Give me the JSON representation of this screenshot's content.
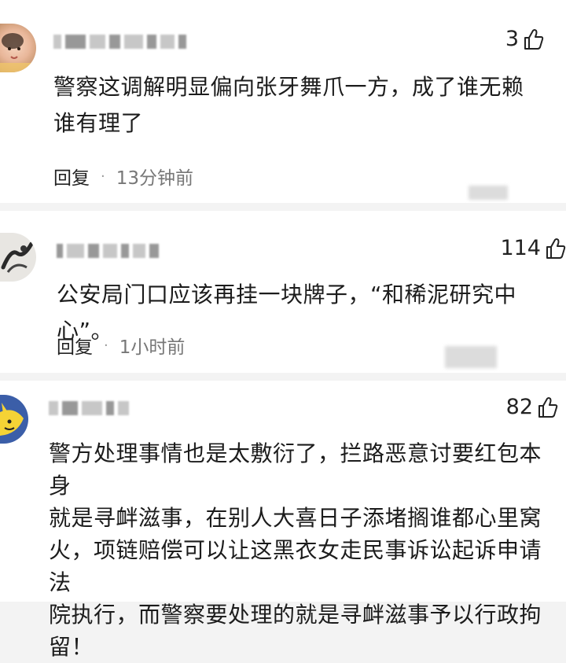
{
  "comments": [
    {
      "likes": "3",
      "text_lines": [
        "警察这调解明显偏向张牙舞爪一方，成了谁无赖",
        "谁有理了"
      ],
      "reply_label": "回复",
      "time": "13分钟前"
    },
    {
      "likes": "114",
      "text_lines": [
        "公安局门口应该再挂一块牌子，“和稀泥研究中心”。"
      ],
      "reply_label": "回复",
      "time": "1小时前"
    },
    {
      "likes": "82",
      "text_lines": [
        "警方处理事情也是太敷衍了，拦路恶意讨要红包本身",
        "就是寻衅滋事，在别人大喜日子添堵搁谁都心里窝",
        "火，项链赔偿可以让这黑衣女走民事诉讼起诉申请法",
        "院执行，而警察要处理的就是寻衅滋事予以行政拘",
        "留！"
      ]
    }
  ],
  "icons": {
    "like": "thumbs-up-icon",
    "avatar_1": "baby-avatar",
    "avatar_2": "ink-painting-avatar",
    "avatar_3": "yellow-cartoon-avatar"
  }
}
